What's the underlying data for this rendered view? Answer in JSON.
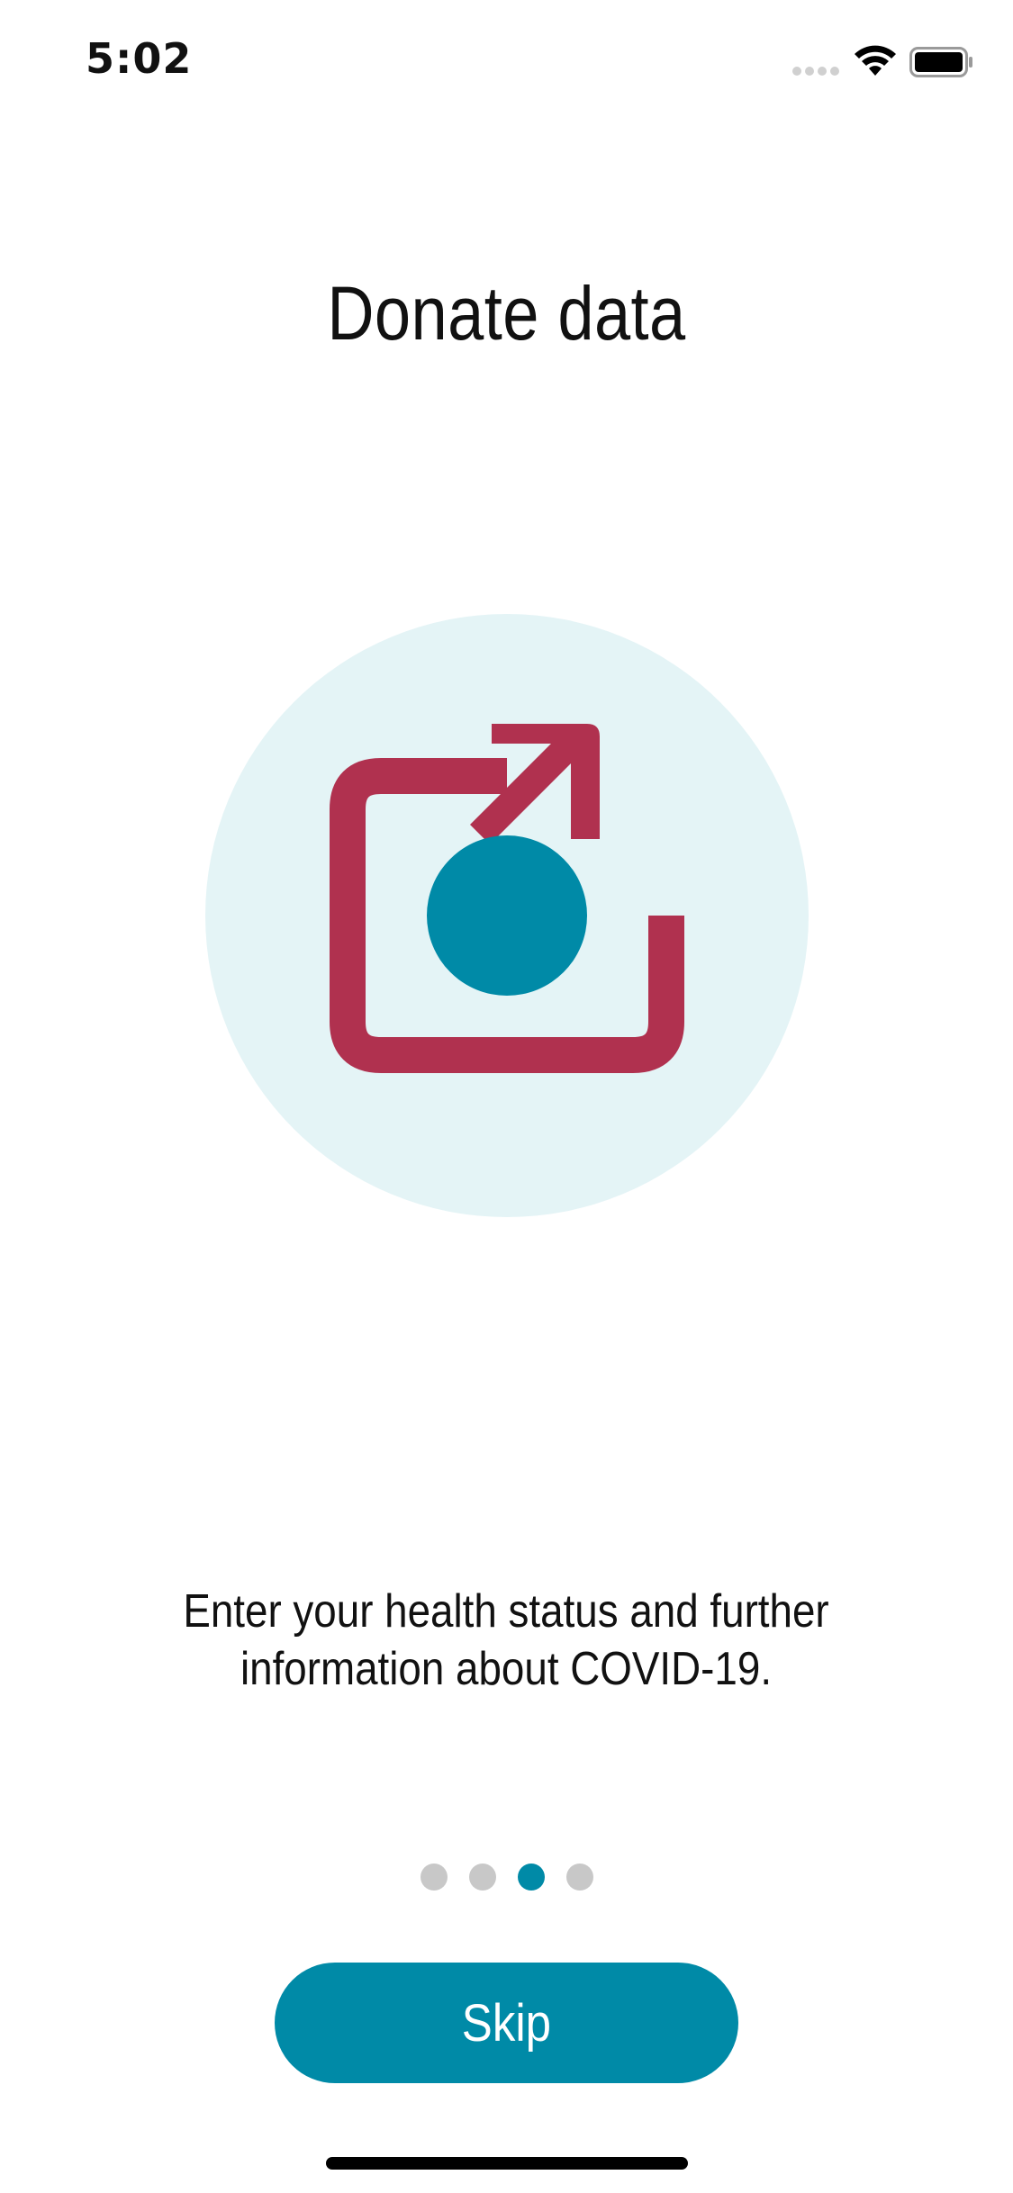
{
  "status_bar": {
    "time": "5:02",
    "icons": [
      "signal-icon",
      "wifi-icon",
      "battery-icon"
    ]
  },
  "page": {
    "title": "Donate data",
    "illustration_icon": "donate-data-icon",
    "description": "Enter your health status and further information about COVID-19."
  },
  "pagination": {
    "total": 4,
    "active_index": 2
  },
  "actions": {
    "skip_label": "Skip"
  },
  "colors": {
    "accent": "#008aa7",
    "brand_red": "#b0314f",
    "circle_bg": "#e4f4f6",
    "dot_inactive": "#c8c8c8"
  }
}
